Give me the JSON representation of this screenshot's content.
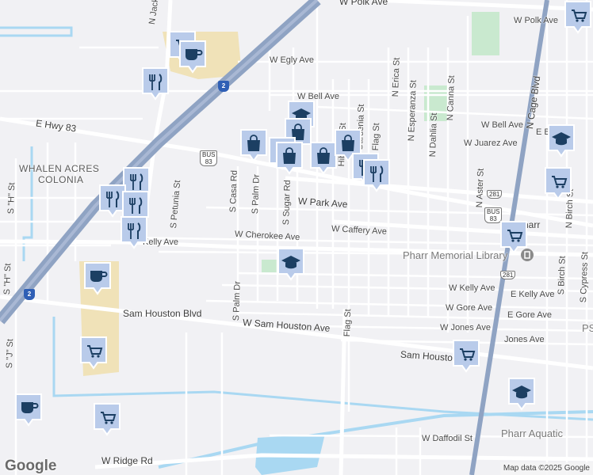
{
  "streets": {
    "w_polk_ave_top": "W Polk Ave",
    "w_polk_ave_right": "W Polk Ave",
    "w_egly_ave": "W Egly Ave",
    "w_bell_ave_left": "W Bell Ave",
    "w_bell_ave_right": "W Bell Ave",
    "e_bell": "E Bell",
    "w_juarez_ave": "W Juarez Ave",
    "e_hwy_83": "E Hwy 83",
    "w_park_ave": "W Park Ave",
    "w_caffery_ave": "W Caffery Ave",
    "w_cherokee_ave": "W Cherokee Ave",
    "kelly_ave_left": "Kelly Ave",
    "w_kelly_ave": "W Kelly Ave",
    "e_kelly_ave": "E Kelly Ave",
    "w_gore_ave": "W Gore Ave",
    "e_gore_ave": "E Gore Ave",
    "w_jones_ave": "W Jones Ave",
    "jones_ave": "Jones Ave",
    "sam_houston_blvd": "Sam Houston Blvd",
    "w_sam_houston_ave": "W Sam Houston Ave",
    "sam_houston_right": "Sam Houston",
    "w_daffodil_st": "W Daffodil St",
    "w_ridge_rd": "W Ridge Rd",
    "n_jackson": "N Jackson",
    "s_petunia_st": "S Petunia St",
    "s_casa_rd": "S Casa Rd",
    "s_palm_dr_top": "S Palm Dr",
    "s_palm_dr_mid": "S Palm Dr",
    "s_sugar_rd": "S Sugar Rd",
    "flag_st_top": "Flag St",
    "flag_st_mid": "Flag St",
    "hibiscus_st": "Hibiscus St",
    "gardenia_st": "Gardenia St",
    "n_erica_st": "N Erica St",
    "n_esperanza_st": "N Esperanza St",
    "n_dahlia_st": "N Dahlia St",
    "n_canna_st": "N Canna St",
    "n_cage_blvd": "N Cage Blvd",
    "n_aster_st": "N Aster St",
    "n_birch_st": "N Birch St",
    "s_birch_st": "S Birch St",
    "s_cypress_st": "S Cypress St",
    "s_h_st": "S \"H\" St",
    "s_j_st": "S \"J\" St",
    "s_h_st_2": "S \"H\" St",
    "pharr_label": "Pharr"
  },
  "areas": {
    "whalen_acres": [
      "WHALEN ACRES",
      "COLONIA"
    ]
  },
  "pois": {
    "library": "Pharr Memorial Library",
    "aquatic": "Pharr Aquatic",
    "ps": "PS"
  },
  "shields": {
    "bus83_a": [
      "BUS",
      "83"
    ],
    "bus83_b": [
      "BUS",
      "83"
    ],
    "us281_a": "281",
    "us281_b": "281",
    "i2_a": "2",
    "i2_b": "2"
  },
  "markers": [
    {
      "kind": "cart"
    },
    {
      "kind": "cart"
    },
    {
      "kind": "cup"
    },
    {
      "kind": "food"
    },
    {
      "kind": "food"
    },
    {
      "kind": "food"
    },
    {
      "kind": "food"
    },
    {
      "kind": "food"
    },
    {
      "kind": "cup"
    },
    {
      "kind": "cart"
    },
    {
      "kind": "cup"
    },
    {
      "kind": "cart"
    },
    {
      "kind": "school"
    },
    {
      "kind": "bag"
    },
    {
      "kind": "bag"
    },
    {
      "kind": "bag"
    },
    {
      "kind": "bag"
    },
    {
      "kind": "bag"
    },
    {
      "kind": "bag"
    },
    {
      "kind": "food"
    },
    {
      "kind": "food"
    },
    {
      "kind": "school"
    },
    {
      "kind": "cart"
    },
    {
      "kind": "cart"
    },
    {
      "kind": "school"
    },
    {
      "kind": "cart"
    },
    {
      "kind": "school"
    }
  ],
  "attribution": {
    "logo": "Google",
    "text": "Map data ©2025 Google"
  },
  "colors": {
    "marker_fill": "#b9cbea",
    "marker_border": "#ffffff",
    "icon": "#1c3f63",
    "land": "#f1f1f4",
    "road": "#ffffff",
    "freeway": "#8fa3c3",
    "water": "#a9d8f2",
    "park": "#c9e9cf",
    "commercial": "#f0e2b8"
  }
}
